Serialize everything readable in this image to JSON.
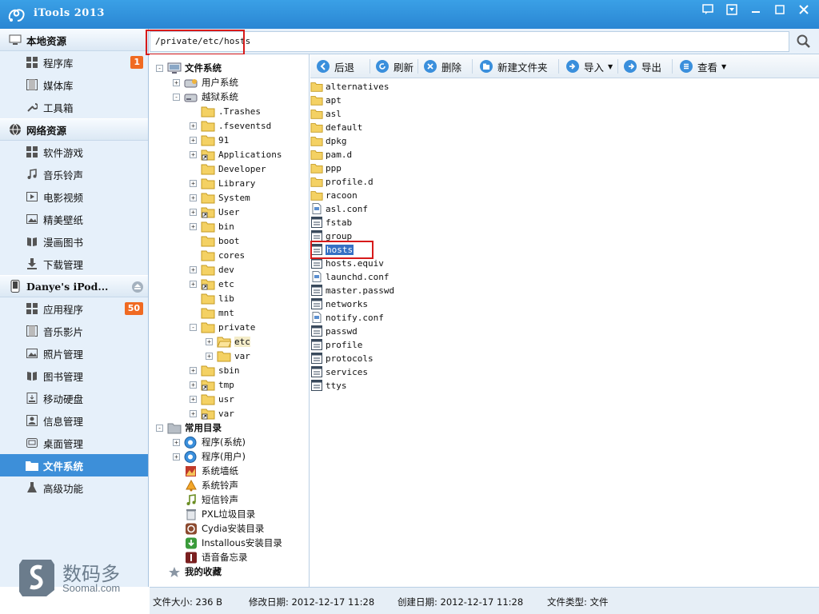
{
  "app": {
    "title": "iTools 2013"
  },
  "address": {
    "path": "/private/etc/hosts",
    "search_icon": "magnifier"
  },
  "sidebar": {
    "sections": [
      {
        "label": "本地资源",
        "icon": "monitor-icon"
      },
      {
        "label": "网络资源",
        "icon": "globe-icon"
      },
      {
        "label": "Danye's iPod...",
        "icon": "ipod-icon"
      }
    ],
    "local_items": [
      {
        "label": "程序库",
        "icon": "grid-icon",
        "badge": "1"
      },
      {
        "label": "媒体库",
        "icon": "film-icon"
      },
      {
        "label": "工具箱",
        "icon": "wrench-icon"
      }
    ],
    "network_items": [
      {
        "label": "软件游戏",
        "icon": "grid-icon"
      },
      {
        "label": "音乐铃声",
        "icon": "music-icon"
      },
      {
        "label": "电影视频",
        "icon": "video-icon"
      },
      {
        "label": "精美壁纸",
        "icon": "picture-icon"
      },
      {
        "label": "漫画图书",
        "icon": "book-icon"
      },
      {
        "label": "下载管理",
        "icon": "download-icon"
      }
    ],
    "device_items": [
      {
        "label": "应用程序",
        "icon": "grid-icon",
        "badge": "50"
      },
      {
        "label": "音乐影片",
        "icon": "film-icon"
      },
      {
        "label": "照片管理",
        "icon": "picture-icon"
      },
      {
        "label": "图书管理",
        "icon": "book-icon"
      },
      {
        "label": "移动硬盘",
        "icon": "drive-icon"
      },
      {
        "label": "信息管理",
        "icon": "contact-icon"
      },
      {
        "label": "桌面管理",
        "icon": "desktop-icon"
      },
      {
        "label": "文件系统",
        "icon": "folder-icon",
        "active": true
      },
      {
        "label": "高级功能",
        "icon": "flask-icon"
      }
    ]
  },
  "tree": {
    "nodes": [
      {
        "label": "文件系统",
        "bold": true,
        "expander": "-",
        "icon": "computer",
        "selected": false
      },
      {
        "label": "用户系统",
        "expander": "+",
        "icon": "drive-user"
      },
      {
        "label": "越狱系统",
        "expander": "-",
        "icon": "drive"
      },
      {
        "label": ".Trashes",
        "mono": true,
        "icon": "folder"
      },
      {
        "label": ".fseventsd",
        "mono": true,
        "expander": "+",
        "icon": "folder"
      },
      {
        "label": "91",
        "mono": true,
        "expander": "+",
        "icon": "folder"
      },
      {
        "label": "Applications",
        "mono": true,
        "expander": "+",
        "icon": "folder-link"
      },
      {
        "label": "Developer",
        "mono": true,
        "icon": "folder"
      },
      {
        "label": "Library",
        "mono": true,
        "expander": "+",
        "icon": "folder"
      },
      {
        "label": "System",
        "mono": true,
        "expander": "+",
        "icon": "folder"
      },
      {
        "label": "User",
        "mono": true,
        "expander": "+",
        "icon": "folder-link"
      },
      {
        "label": "bin",
        "mono": true,
        "expander": "+",
        "icon": "folder"
      },
      {
        "label": "boot",
        "mono": true,
        "icon": "folder"
      },
      {
        "label": "cores",
        "mono": true,
        "icon": "folder"
      },
      {
        "label": "dev",
        "mono": true,
        "expander": "+",
        "icon": "folder"
      },
      {
        "label": "etc",
        "mono": true,
        "expander": "+",
        "icon": "folder-link"
      },
      {
        "label": "lib",
        "mono": true,
        "icon": "folder"
      },
      {
        "label": "mnt",
        "mono": true,
        "icon": "folder"
      },
      {
        "label": "private",
        "mono": true,
        "expander": "-",
        "icon": "folder"
      },
      {
        "label": "etc",
        "mono": true,
        "expander": "+",
        "icon": "folder-open",
        "selected": true
      },
      {
        "label": "var",
        "mono": true,
        "expander": "+",
        "icon": "folder"
      },
      {
        "label": "sbin",
        "mono": true,
        "expander": "+",
        "icon": "folder"
      },
      {
        "label": "tmp",
        "mono": true,
        "expander": "+",
        "icon": "folder-link"
      },
      {
        "label": "usr",
        "mono": true,
        "expander": "+",
        "icon": "folder"
      },
      {
        "label": "var",
        "mono": true,
        "expander": "+",
        "icon": "folder-link"
      },
      {
        "label": "常用目录",
        "bold": true,
        "expander": "-",
        "icon": "folder-gray"
      },
      {
        "label": "程序(系统)",
        "expander": "+",
        "icon": "app-blue"
      },
      {
        "label": "程序(用户)",
        "expander": "+",
        "icon": "app-blue"
      },
      {
        "label": "系统墙纸",
        "icon": "wallpaper"
      },
      {
        "label": "系统铃声",
        "icon": "bell"
      },
      {
        "label": "短信铃声",
        "icon": "note"
      },
      {
        "label": "PXL垃圾目录",
        "icon": "trash"
      },
      {
        "label": "Cydia安装目录",
        "icon": "cydia"
      },
      {
        "label": "Installous安装目录",
        "icon": "installous"
      },
      {
        "label": "语音备忘录",
        "icon": "memo"
      },
      {
        "label": "我的收藏",
        "bold": true,
        "icon": "star"
      }
    ]
  },
  "toolbar": {
    "back": "后退",
    "refresh": "刷新",
    "delete": "删除",
    "new_folder": "新建文件夹",
    "import": "导入",
    "export": "导出",
    "view": "查看"
  },
  "files": [
    {
      "name": "alternatives",
      "type": "folder"
    },
    {
      "name": "apt",
      "type": "folder"
    },
    {
      "name": "asl",
      "type": "folder"
    },
    {
      "name": "default",
      "type": "folder"
    },
    {
      "name": "dpkg",
      "type": "folder"
    },
    {
      "name": "pam.d",
      "type": "folder"
    },
    {
      "name": "ppp",
      "type": "folder"
    },
    {
      "name": "profile.d",
      "type": "folder"
    },
    {
      "name": "racoon",
      "type": "folder"
    },
    {
      "name": "asl.conf",
      "type": "conf"
    },
    {
      "name": "fstab",
      "type": "file"
    },
    {
      "name": "group",
      "type": "file"
    },
    {
      "name": "hosts",
      "type": "file",
      "selected": true
    },
    {
      "name": "hosts.equiv",
      "type": "file"
    },
    {
      "name": "launchd.conf",
      "type": "conf"
    },
    {
      "name": "master.passwd",
      "type": "file"
    },
    {
      "name": "networks",
      "type": "file"
    },
    {
      "name": "notify.conf",
      "type": "conf"
    },
    {
      "name": "passwd",
      "type": "file"
    },
    {
      "name": "profile",
      "type": "file"
    },
    {
      "name": "protocols",
      "type": "file"
    },
    {
      "name": "services",
      "type": "file"
    },
    {
      "name": "ttys",
      "type": "file"
    }
  ],
  "status": {
    "size": "文件大小: 236 B",
    "modified": "修改日期: 2012-12-17 11:28",
    "created": "创建日期: 2012-12-17 11:28",
    "type": "文件类型: 文件"
  },
  "watermark": {
    "text": "数码多",
    "sub": "Soomal.com"
  },
  "colors": {
    "accent": "#3d8fd9",
    "title_bar": "#2a86d3",
    "badge": "#f06a22",
    "highlight": "#d71a1a"
  }
}
